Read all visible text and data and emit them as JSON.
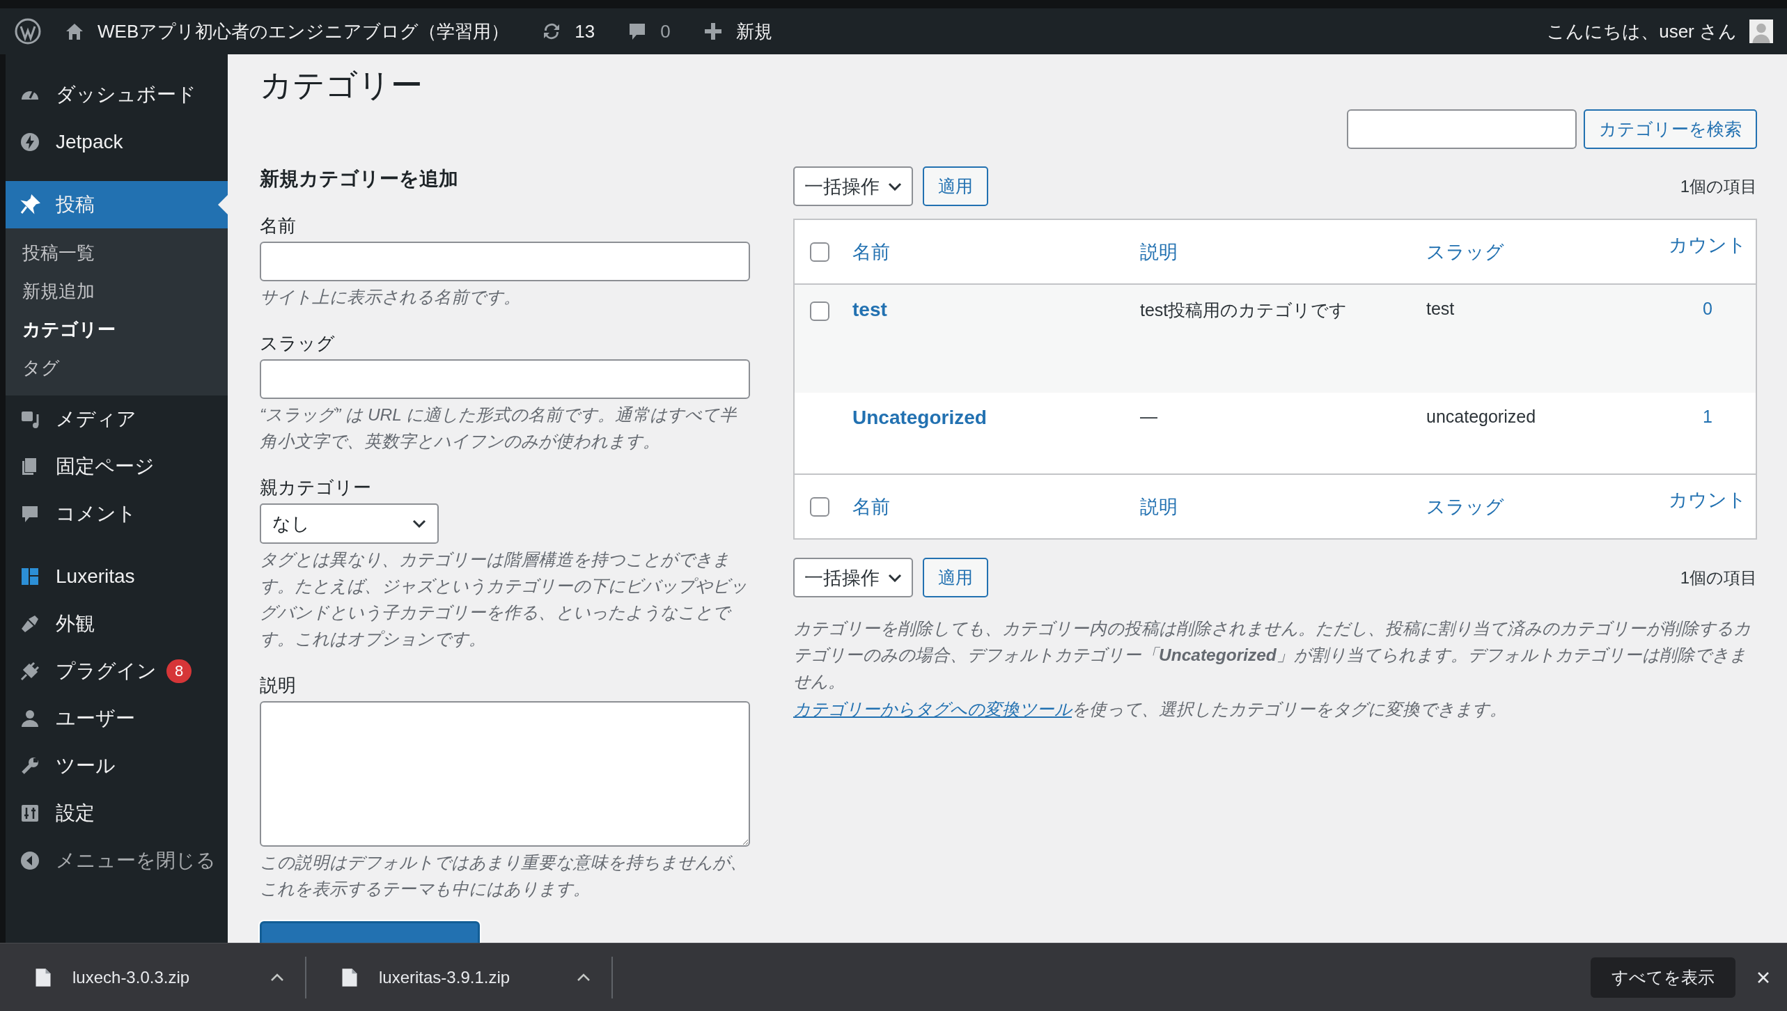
{
  "admin_bar": {
    "site_title": "WEBアプリ初心者のエンジニアブログ（学習用）",
    "updates_count": "13",
    "comments_count": "0",
    "new_label": "新規",
    "greeting": "こんにちは、user さん"
  },
  "sidebar": {
    "items": [
      {
        "kind": "menu",
        "label": "ダッシュボード",
        "selected": false
      },
      {
        "kind": "menu",
        "label": "Jetpack",
        "selected": false
      },
      {
        "kind": "menu",
        "label": "投稿",
        "selected": true,
        "children": [
          {
            "label": "投稿一覧",
            "selected": false
          },
          {
            "label": "新規追加",
            "selected": false
          },
          {
            "label": "カテゴリー",
            "selected": true
          },
          {
            "label": "タグ",
            "selected": false
          }
        ]
      },
      {
        "kind": "menu",
        "label": "メディア",
        "selected": false
      },
      {
        "kind": "menu",
        "label": "固定ページ",
        "selected": false
      },
      {
        "kind": "menu",
        "label": "コメント",
        "selected": false
      },
      {
        "kind": "menu",
        "label": "Luxeritas",
        "selected": false
      },
      {
        "kind": "menu",
        "label": "外観",
        "selected": false
      },
      {
        "kind": "menu",
        "label": "プラグイン",
        "selected": false,
        "badge": "8"
      },
      {
        "kind": "menu",
        "label": "ユーザー",
        "selected": false
      },
      {
        "kind": "menu",
        "label": "ツール",
        "selected": false
      },
      {
        "kind": "menu",
        "label": "設定",
        "selected": false
      },
      {
        "kind": "collapse",
        "label": "メニューを閉じる",
        "selected": false
      }
    ]
  },
  "page_title": "カテゴリー",
  "add_form": {
    "heading": "新規カテゴリーを追加",
    "fields": [
      {
        "kind": "text",
        "label": "名前",
        "hint": "サイト上に表示される名前です。"
      },
      {
        "kind": "text",
        "label": "スラッグ",
        "hint": "“スラッグ” は URL に適した形式の名前です。通常はすべて半角小文字で、英数字とハイフンのみが使われます。"
      },
      {
        "kind": "select",
        "label": "親カテゴリー",
        "value": "なし",
        "hint": "タグとは異なり、カテゴリーは階層構造を持つことができます。たとえば、ジャズというカテゴリーの下にビバップやビッグバンドという子カテゴリーを作る、といったようなことです。これはオプションです。"
      },
      {
        "kind": "textarea",
        "label": "説明",
        "hint": "この説明はデフォルトではあまり重要な意味を持ちませんが、これを表示するテーマも中にはあります。"
      }
    ]
  },
  "search": {
    "button": "カテゴリーを検索"
  },
  "top_actions": {
    "bulk_action": "一括操作",
    "apply": "適用",
    "items_count": "1個の項目"
  },
  "table": {
    "columns": [
      "名前",
      "説明",
      "スラッグ",
      "カウント"
    ],
    "footer_columns": [
      "名前",
      "説明",
      "スラッグ",
      "カウント"
    ],
    "header_checked": false,
    "footer_checked": false,
    "rows": [
      {
        "name": "test",
        "description": "test投稿用のカテゴリです",
        "slug": "test",
        "count": "0",
        "checked": false
      },
      {
        "name": "Uncategorized",
        "description": "—",
        "slug": "uncategorized",
        "count": "1"
      }
    ]
  },
  "bottom_actions": {
    "bulk_action": "一括操作",
    "apply": "適用",
    "items_count": "1個の項目"
  },
  "notes": {
    "text": "カテゴリーを削除しても、カテゴリー内の投稿は削除されません。ただし、投稿に割り当て済みのカテゴリーが削除するカテゴリーのみの場合、デフォルトカテゴリー「**Uncategorized**」が割り当てられます。デフォルトカテゴリーは削除できません。",
    "link": "カテゴリーからタグへの変換ツール",
    "link_suffix": "を使って、選択したカテゴリーをタグに変換できます。"
  },
  "downloads": {
    "files": [
      {
        "filename": "luxech-3.0.3.zip"
      },
      {
        "filename": "luxeritas-3.9.1.zip"
      }
    ],
    "show_all": "すべてを表示"
  }
}
